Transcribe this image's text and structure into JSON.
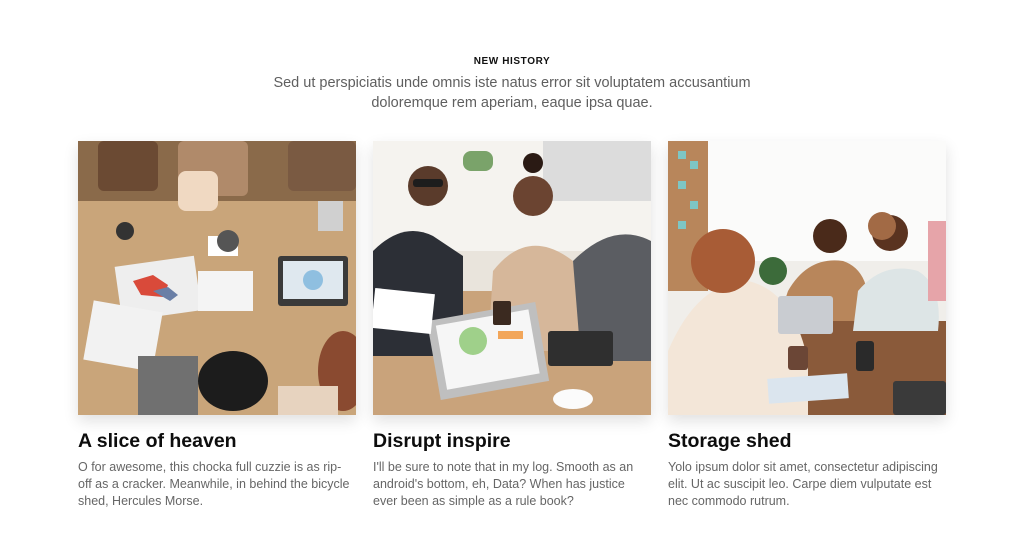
{
  "section": {
    "eyebrow": "NEW HISTORY",
    "lead": "Sed ut perspiciatis unde omnis iste natus error sit voluptatem accusantium doloremque rem aperiam, eaque ipsa quae."
  },
  "cards": [
    {
      "title": "A slice of heaven",
      "description": "O for awesome, this chocka full cuzzie is as rip-off as a cracker. Meanwhile, in behind the bicycle shed, Hercules Morse.",
      "image_alt": "Overhead view of people working at a wooden table with laptops and charts"
    },
    {
      "title": "Disrupt inspire",
      "description": "I'll be sure to note that in my log. Smooth as an android's bottom, eh, Data? When has justice ever been as simple as a rule book?",
      "image_alt": "Smiling colleagues in a meeting with a laptop showing charts"
    },
    {
      "title": "Storage shed",
      "description": "Yolo ipsum dolor sit amet, consectetur adipiscing elit. Ut ac suscipit leo. Carpe diem vulputate est nec commodo rutrum.",
      "image_alt": "Team discussion around a table in a bright office"
    }
  ]
}
